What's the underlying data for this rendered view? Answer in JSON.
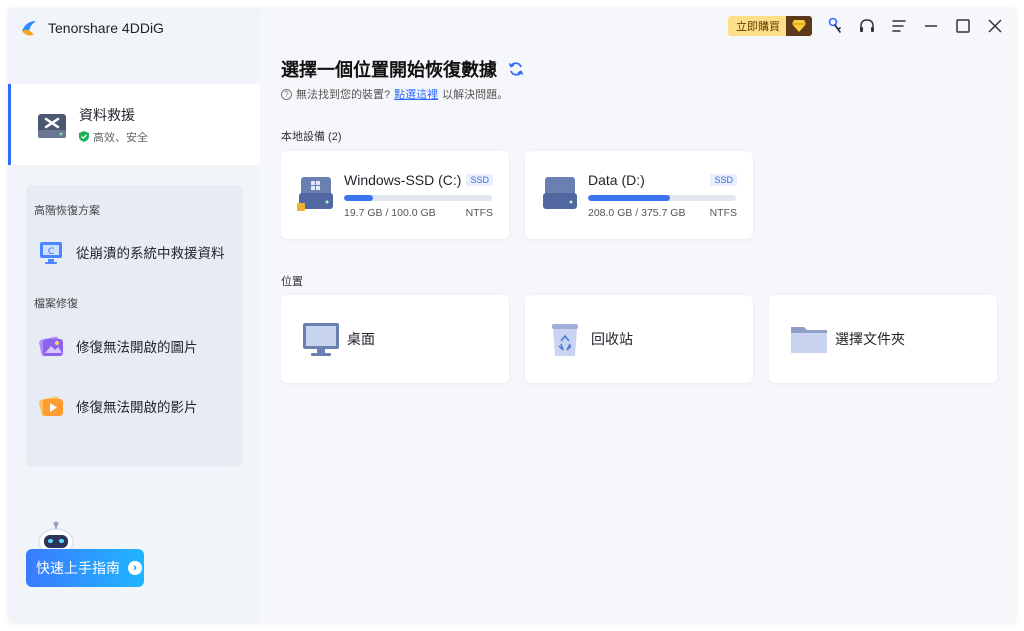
{
  "app": {
    "name": "Tenorshare 4DDiG"
  },
  "sidebar": {
    "active_item": {
      "title": "資料救援",
      "subtitle": "高效、安全"
    },
    "advanced": {
      "heading": "高階恢復方案",
      "items": [
        {
          "label": "從崩潰的系統中救援資料"
        }
      ]
    },
    "repair": {
      "heading": "檔案修復",
      "items": [
        {
          "label": "修復無法開啟的圖片"
        },
        {
          "label": "修復無法開啟的影片"
        }
      ]
    },
    "guide_button": "快速上手指南"
  },
  "titlebar": {
    "buy_label": "立即購買"
  },
  "main": {
    "title": "選擇一個位置開始恢復數據",
    "help": {
      "prefix": "無法找到您的裝置?",
      "link": "點選這裡",
      "suffix": "以解決問題。"
    },
    "local_devices_label": "本地設備 (2)",
    "drives": [
      {
        "name": "Windows-SSD (C:)",
        "badge": "SSD",
        "size": "19.7 GB / 100.0 GB",
        "fs": "NTFS",
        "used_fraction": 0.197
      },
      {
        "name": "Data (D:)",
        "badge": "SSD",
        "size": "208.0 GB / 375.7 GB",
        "fs": "NTFS",
        "used_fraction": 0.554
      }
    ],
    "locations_label": "位置",
    "locations": [
      {
        "label": "桌面"
      },
      {
        "label": "回收站"
      },
      {
        "label": "選擇文件夾"
      }
    ]
  },
  "colors": {
    "accent": "#2f6bff",
    "bar_fill": "#3c73f0",
    "buy_bg": "#ffe08a"
  },
  "icons": [
    "app-logo-icon",
    "data-recovery-icon",
    "shield-check-icon",
    "crash-system-icon",
    "photo-repair-icon",
    "video-repair-icon",
    "robot-icon",
    "refresh-icon",
    "question-icon",
    "drive-windows-icon",
    "drive-icon",
    "desktop-icon",
    "recycle-bin-icon",
    "folder-icon",
    "key-icon",
    "headset-icon",
    "menu-icon",
    "minimize-icon",
    "maximize-icon",
    "close-icon"
  ]
}
